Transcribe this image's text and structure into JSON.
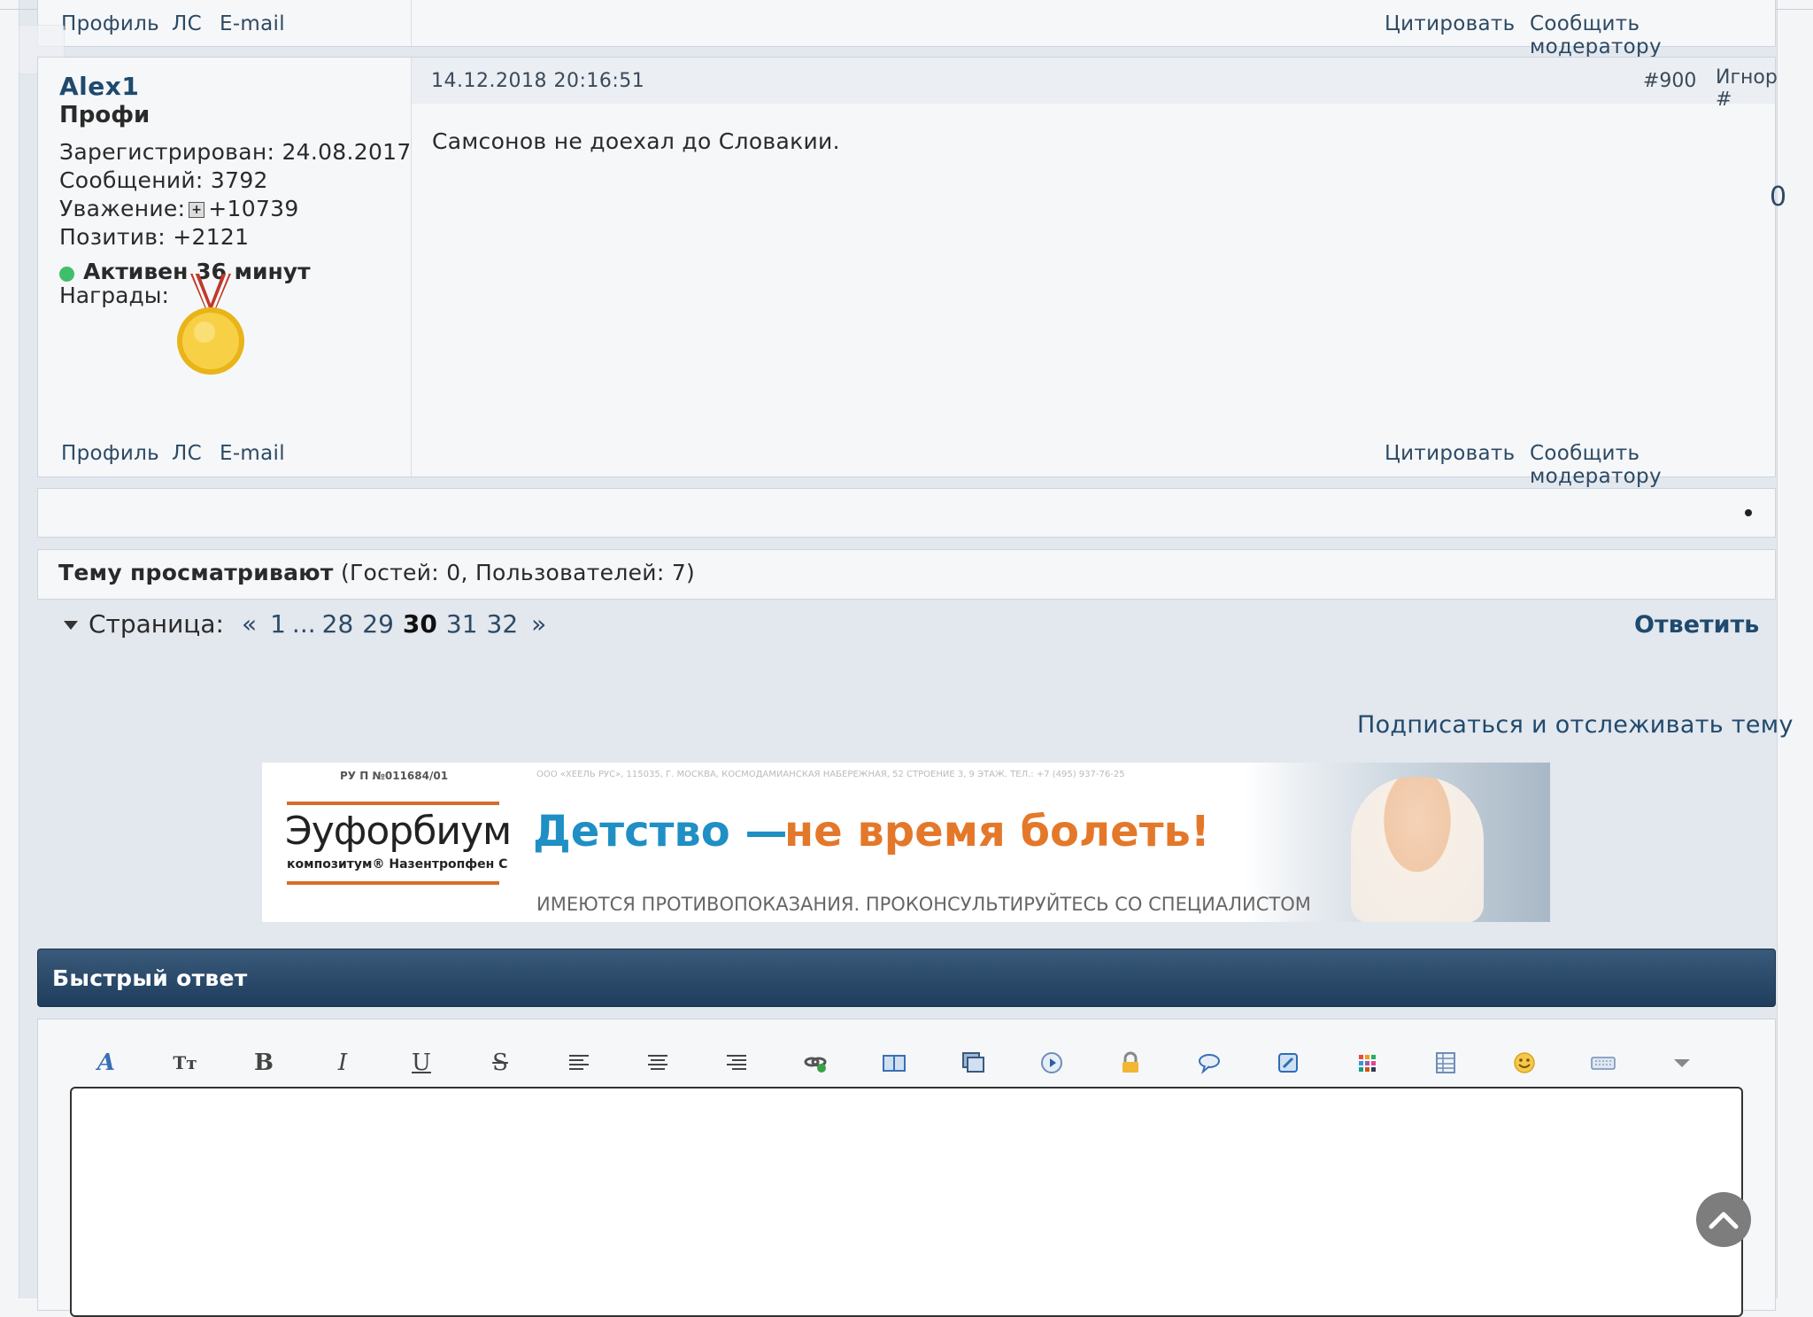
{
  "post_prev": {
    "footer_left": [
      "Профиль",
      "ЛС",
      "E-mail"
    ],
    "footer_right": [
      "Цитировать",
      "Сообщить модератору"
    ]
  },
  "post": {
    "username": "Alex1",
    "rank": "Профи",
    "registered": "Зарегистрирован: 24.08.2017",
    "messages": "Сообщений: 3792",
    "respect_label": "Уважение:",
    "respect_value": "+10739",
    "positive": "Позитив: +2121",
    "online": "Активен 36 минут",
    "awards_label": "Награды:",
    "date": "14.12.2018 20:16:51",
    "number": "#900",
    "ignore": "Игнор #",
    "body": "Самсонов не доехал до Словакии.",
    "score": "0",
    "footer_left": [
      "Профиль",
      "ЛС",
      "E-mail"
    ],
    "footer_right": [
      "Цитировать",
      "Сообщить модератору"
    ]
  },
  "viewers": {
    "bold": "Тему просматривают",
    "rest": " (Гостей: 0, Пользователей: 7)"
  },
  "pager": {
    "label": "Страница:",
    "prev": "«",
    "pages": [
      "1",
      "...",
      "28",
      "29"
    ],
    "current": "30",
    "next_pages": [
      "31",
      "32"
    ],
    "next": "»",
    "reply": "Ответить"
  },
  "subscribe": "Подписаться и отслеживать тему",
  "banner": {
    "reg": "РУ П №011684/01",
    "fine": "ООО «ХЕЕЛЬ РУС», 115035, Г. МОСКВА, КОСМОДАМИАНСКАЯ НАБЕРЕЖНАЯ, 52 СТРОЕНИЕ 3, 9 ЭТАЖ. ТЕЛ.: +7 (495) 937-76-25",
    "brand": "Эуфорбиум",
    "brand_sub": "композитум® Назентропфен С",
    "slogan_blue": "Детство —",
    "slogan_orange": "не время болеть!",
    "disclaimer": "ИМЕЮТСЯ ПРОТИВОПОКАЗАНИЯ. ПРОКОНСУЛЬТИРУЙТЕСЬ СО СПЕЦИАЛИСТОМ"
  },
  "quick_reply": {
    "title": "Быстрый ответ"
  },
  "toolbar_icons": [
    "font-icon",
    "font-size-icon",
    "bold-icon",
    "italic-icon",
    "underline-icon",
    "strikethrough-icon",
    "align-left-icon",
    "align-center-icon",
    "align-right-icon",
    "link-icon",
    "book-icon",
    "media-icon",
    "play-icon",
    "lock-icon",
    "speech-bubble-icon",
    "code-icon",
    "color-grid-icon",
    "table-icon",
    "smiley-icon",
    "keyboard-icon",
    "dropdown-arrow-icon"
  ],
  "colors": {
    "link": "#2d4a64",
    "header_bar": "#1f3d5c",
    "online": "#3fbf6a",
    "banner_blue": "#1f8fc4",
    "banner_orange": "#e4782a"
  }
}
